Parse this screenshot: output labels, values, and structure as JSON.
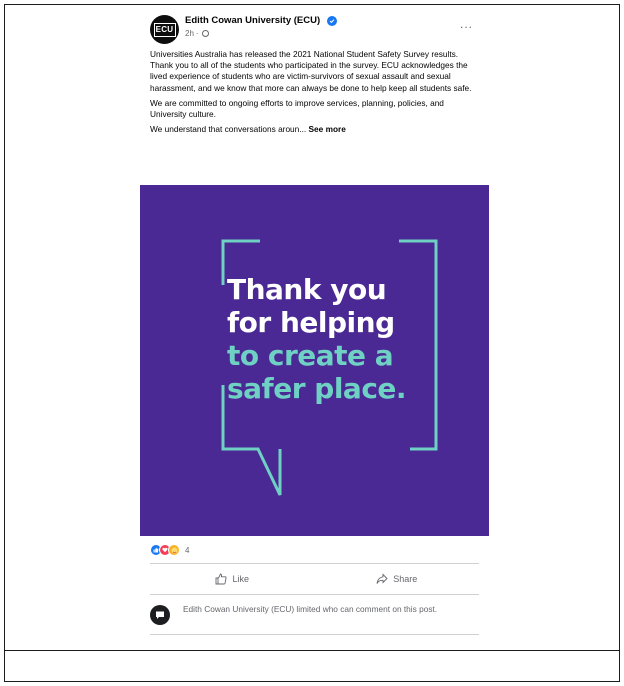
{
  "post": {
    "page_name": "Edith Cowan University (ECU)",
    "avatar_logo": "ECU",
    "time": "2h",
    "time_separator": "·",
    "more_label": "...",
    "paragraphs": [
      "Universities Australia has released the 2021 National Student Safety Survey results. Thank you to all of the students who participated in the survey. ECU acknowledges the lived experience of students who are victim-survivors of sexual assault and sexual harassment, and we know that more can always be done to help keep all students safe.",
      "We are committed to ongoing efforts to improve services, planning, policies, and University culture."
    ],
    "truncated_text": "We understand that conversations aroun...",
    "see_more_label": "See more"
  },
  "media": {
    "headline_lines_white": [
      "Thank you",
      "for helping"
    ],
    "headline_lines_teal": [
      "to create a",
      "safer place."
    ],
    "background_color": "#4b2994",
    "accent_color": "#6fd0c4"
  },
  "reactions": {
    "count": "4",
    "types": [
      "like-icon",
      "love-icon",
      "care-icon"
    ]
  },
  "actions": {
    "like_label": "Like",
    "share_label": "Share"
  },
  "comment_notice": "Edith Cowan University (ECU) limited who can comment on this post."
}
